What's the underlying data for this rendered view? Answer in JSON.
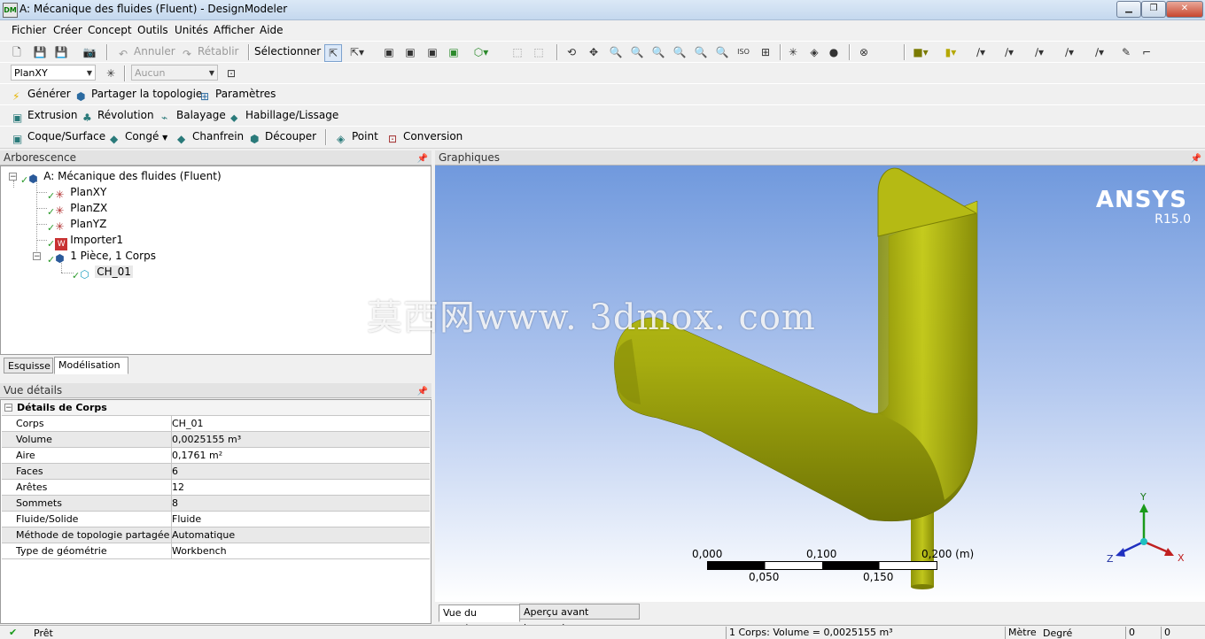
{
  "window": {
    "title": "A: Mécanique des fluides (Fluent) - DesignModeler",
    "app_icon_text": "DM"
  },
  "menu": [
    "Fichier",
    "Créer",
    "Concept",
    "Outils",
    "Unités",
    "Afficher",
    "Aide"
  ],
  "toolbar1": {
    "undo_label": "Annuler",
    "redo_label": "Rétablir",
    "select_label": "Sélectionner :"
  },
  "toolbar2": {
    "plane_value": "PlanXY",
    "sketch_value": "Aucun"
  },
  "toolbar3": {
    "generate_label": "Générer",
    "share_topology_label": "Partager la topologie",
    "parameters_label": "Paramètres"
  },
  "toolbar4": {
    "extrude_label": "Extrusion",
    "revolve_label": "Révolution",
    "sweep_label": "Balayage",
    "skin_label": "Habillage/Lissage"
  },
  "toolbar5": {
    "shell_label": "Coque/Surface",
    "blend_label": "Congé",
    "chamfer_label": "Chanfrein",
    "slice_label": "Découper",
    "point_label": "Point",
    "conversion_label": "Conversion"
  },
  "tree_panel": {
    "title": "Arborescence",
    "root": "A: Mécanique des fluides (Fluent)",
    "items": [
      "PlanXY",
      "PlanZX",
      "PlanYZ",
      "Importer1",
      "1 Pièce, 1 Corps"
    ],
    "body": "CH_01",
    "tabs": [
      "Esquisse",
      "Modélisation"
    ]
  },
  "details_panel": {
    "title": "Vue détails",
    "section": "Détails de Corps",
    "rows": [
      {
        "k": "Corps",
        "v": "CH_01"
      },
      {
        "k": "Volume",
        "v": "0,0025155 m³"
      },
      {
        "k": "Aire",
        "v": "0,1761 m²"
      },
      {
        "k": "Faces",
        "v": "6"
      },
      {
        "k": "Arêtes",
        "v": "12"
      },
      {
        "k": "Sommets",
        "v": "8"
      },
      {
        "k": "Fluide/Solide",
        "v": "Fluide"
      },
      {
        "k": "Méthode de topologie partagée",
        "v": "Automatique"
      },
      {
        "k": "Type de géométrie",
        "v": "Workbench"
      }
    ]
  },
  "graphics_panel": {
    "title": "Graphiques",
    "brand": "ANSYS",
    "version": "R15.0",
    "watermark": "莫西网www. 3dmox. com",
    "scale_top": [
      "0,000",
      "0,100",
      "0,200 (m)"
    ],
    "scale_bottom": [
      "0,050",
      "0,150"
    ],
    "axes": {
      "x": "X",
      "y": "Y",
      "z": "Z"
    },
    "tabs": [
      "Vue du modèle",
      "Aperçu avant impression"
    ],
    "model_color": "#a7ad10"
  },
  "status": {
    "ready": "Prêt",
    "info": "1 Corps: Volume = 0,0025155 m³",
    "units_length": "Mètre",
    "units_angle": "Degré",
    "v1": "0",
    "v2": "0"
  }
}
